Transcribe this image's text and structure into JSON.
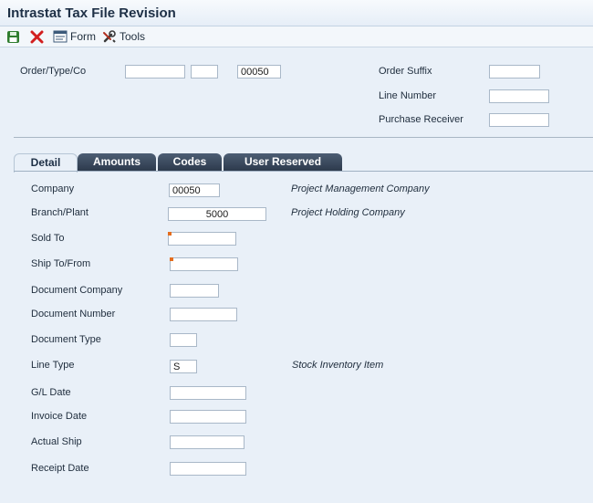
{
  "window": {
    "title": "Intrastat Tax File Revision"
  },
  "toolbar": {
    "save_icon": "save-icon",
    "cancel_icon": "close-icon",
    "form_label": "Form",
    "tools_label": "Tools"
  },
  "header": {
    "order_type_co_label": "Order/Type/Co",
    "order_number": "",
    "order_type": "",
    "order_company": "00050",
    "order_suffix_label": "Order Suffix",
    "order_suffix": "",
    "line_number_label": "Line Number",
    "line_number": "",
    "purchase_receiver_label": "Purchase Receiver",
    "purchase_receiver": ""
  },
  "tabs": [
    {
      "label": "Detail",
      "active": true
    },
    {
      "label": "Amounts",
      "active": false
    },
    {
      "label": "Codes",
      "active": false
    },
    {
      "label": "User Reserved",
      "active": false
    }
  ],
  "detail": {
    "company_label": "Company",
    "company": "00050",
    "company_desc": "Project Management Company",
    "branch_plant_label": "Branch/Plant",
    "branch_plant": "5000",
    "branch_plant_desc": "Project Holding Company",
    "sold_to_label": "Sold To",
    "sold_to": "",
    "ship_to_from_label": "Ship To/From",
    "ship_to_from": "",
    "document_company_label": "Document Company",
    "document_company": "",
    "document_number_label": "Document Number",
    "document_number": "",
    "document_type_label": "Document Type",
    "document_type": "",
    "line_type_label": "Line Type",
    "line_type": "S",
    "line_type_desc": "Stock Inventory Item",
    "gl_date_label": "G/L Date",
    "gl_date": "",
    "invoice_date_label": "Invoice Date",
    "invoice_date": "",
    "actual_ship_label": "Actual Ship",
    "actual_ship": "",
    "receipt_date_label": "Receipt Date",
    "receipt_date": ""
  },
  "colors": {
    "background": "#e9f0f8",
    "tab_dark": "#2d3a4c",
    "required_marker": "#e46d1e",
    "cancel_red": "#d21f1f",
    "save_green": "#2f7d2f"
  }
}
